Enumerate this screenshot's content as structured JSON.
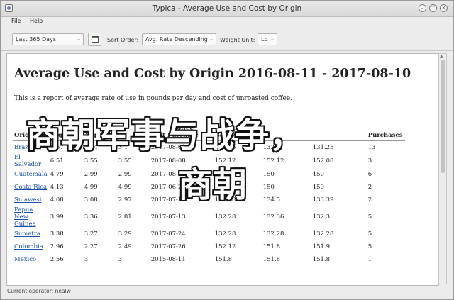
{
  "window": {
    "title": "Typica - Average Use and Cost by Origin"
  },
  "menu": {
    "file": "File",
    "help": "Help"
  },
  "toolbar": {
    "date_range": "Last 365 Days",
    "sort_label": "Sort Order:",
    "sort_value": "Avg. Rate Descending",
    "unit_label": "Weight Unit:",
    "unit_value": "Lb"
  },
  "report": {
    "title": "Average Use and Cost by Origin 2016-08-11 - 2017-08-10",
    "description": "This is a report of average rate of use in pounds per day and cost of unroasted coffee.",
    "headers": [
      "Origin",
      "Avg",
      "Avg",
      "",
      "Last Purchase",
      "Bag Size",
      "",
      "",
      "Purchases"
    ],
    "header_extra": "Coffee",
    "rows": [
      [
        "Brazil",
        "9.67",
        "2.64",
        "3.1",
        "2017-08-01",
        "131.25",
        "132.3",
        "131.25",
        "13"
      ],
      [
        "El Salvador",
        "6.51",
        "3.55",
        "3.55",
        "2017-08-08",
        "152.12",
        "152.12",
        "152.08",
        "3"
      ],
      [
        "Guatemala",
        "4.79",
        "2.99",
        "2.99",
        "2017-08-02",
        "150",
        "150",
        "150",
        "6"
      ],
      [
        "Costa Rica",
        "4.13",
        "4.99",
        "4.99",
        "2017-06-21",
        "150",
        "150",
        "150",
        "2"
      ],
      [
        "Sulawesi",
        "4.08",
        "3.08",
        "2.97",
        "2017-07-13",
        "132.28",
        "134.5",
        "133.39",
        "2"
      ],
      [
        "Papua New Guinea",
        "3.99",
        "3.36",
        "2.81",
        "2017-07-13",
        "132.28",
        "132.36",
        "132.3",
        "5"
      ],
      [
        "Sumatra",
        "3.38",
        "3.27",
        "3.29",
        "2017-07-24",
        "132.28",
        "132.28",
        "132.28",
        "5"
      ],
      [
        "Colombia",
        "2.96",
        "2.27",
        "2.49",
        "2017-07-26",
        "152.12",
        "151.8",
        "151.9",
        "5"
      ],
      [
        "Mexico",
        "2.56",
        "3",
        "3",
        "2015-08-11",
        "151.8",
        "151.8",
        "151.8",
        "1"
      ]
    ]
  },
  "overlay": {
    "line1": "商朝军事与战争，",
    "line2": "商朝"
  },
  "status": {
    "text": "Current operator: nealw"
  }
}
